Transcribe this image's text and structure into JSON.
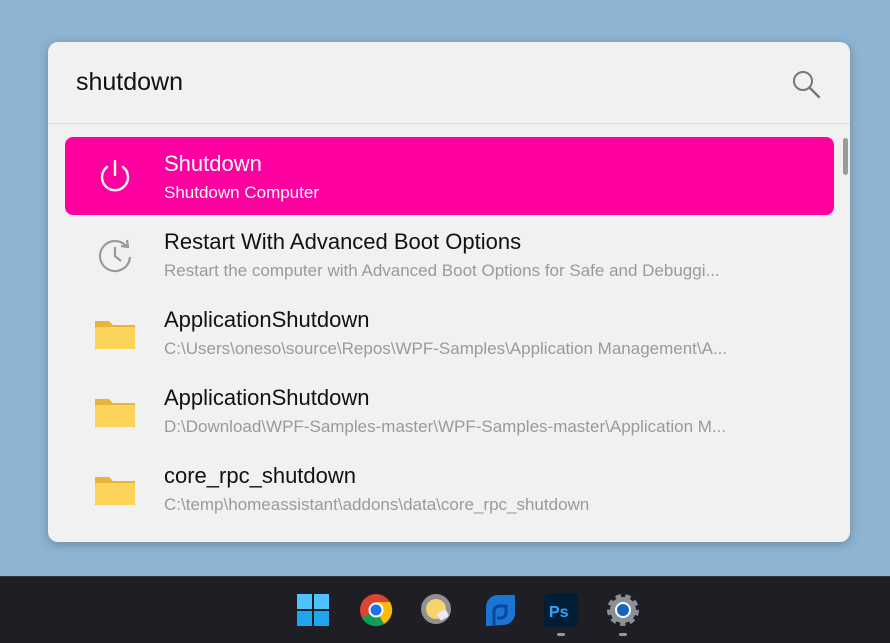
{
  "search": {
    "value": "shutdown",
    "icon": "search-icon"
  },
  "accent": "#ff00a0",
  "results": [
    {
      "title": "Shutdown",
      "subtitle": "Shutdown Computer",
      "icon": "power-icon",
      "selected": true
    },
    {
      "title": "Restart With Advanced Boot Options",
      "subtitle": "Restart the computer with Advanced Boot Options for Safe and Debuggi...",
      "icon": "restart-clock-icon"
    },
    {
      "title": "ApplicationShutdown",
      "subtitle": "C:\\Users\\oneso\\source\\Repos\\WPF-Samples\\Application Management\\A...",
      "icon": "folder-icon"
    },
    {
      "title": "ApplicationShutdown",
      "subtitle": "D:\\Download\\WPF-Samples-master\\WPF-Samples-master\\Application M...",
      "icon": "folder-icon"
    },
    {
      "title": "core_rpc_shutdown",
      "subtitle": "C:\\temp\\homeassistant\\addons\\data\\core_rpc_shutdown",
      "icon": "folder-icon"
    }
  ],
  "taskbar": [
    "windows-start-icon",
    "chrome-icon",
    "weather-app-icon",
    "blue-app-icon",
    "photoshop-icon",
    "settings-icon"
  ]
}
